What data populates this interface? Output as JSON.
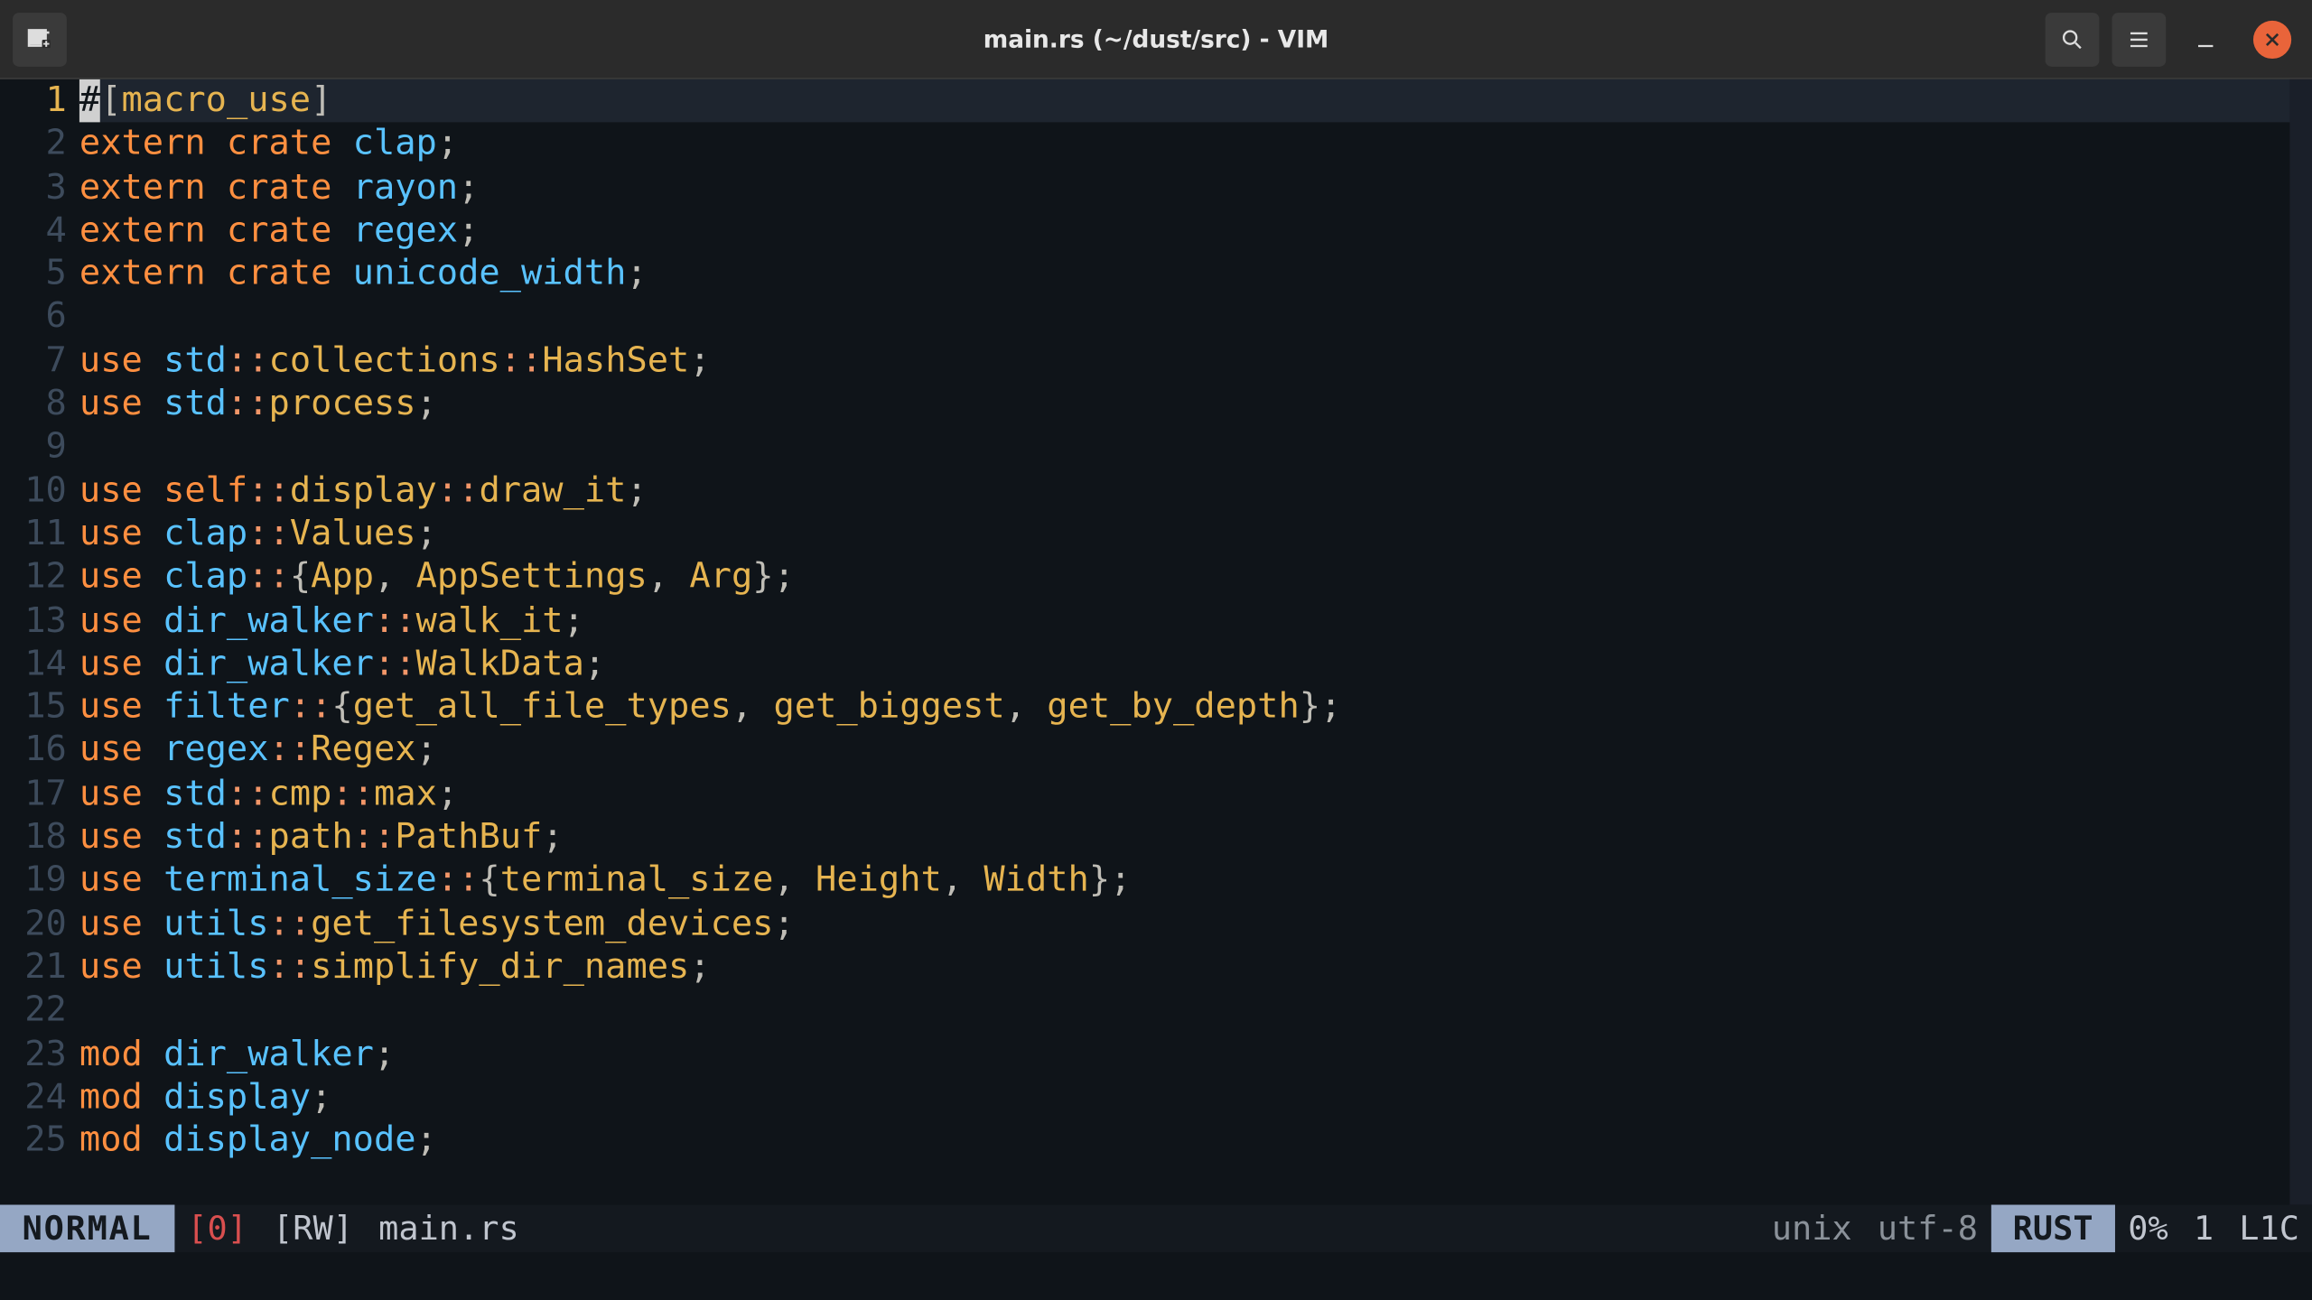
{
  "window": {
    "title": "main.rs (~/dust/src) - VIM"
  },
  "editor": {
    "current_line": 1,
    "lines": [
      {
        "n": 1,
        "tokens": [
          {
            "cursor": true,
            "t": "#"
          },
          {
            "c": "brkt",
            "t": "["
          },
          {
            "c": "attr",
            "t": "macro_use"
          },
          {
            "c": "brkt",
            "t": "]"
          }
        ]
      },
      {
        "n": 2,
        "tokens": [
          {
            "c": "kw",
            "t": "extern crate "
          },
          {
            "c": "ty",
            "t": "clap"
          },
          {
            "c": "punc",
            "t": ";"
          }
        ]
      },
      {
        "n": 3,
        "tokens": [
          {
            "c": "kw",
            "t": "extern crate "
          },
          {
            "c": "ty",
            "t": "rayon"
          },
          {
            "c": "punc",
            "t": ";"
          }
        ]
      },
      {
        "n": 4,
        "tokens": [
          {
            "c": "kw",
            "t": "extern crate "
          },
          {
            "c": "ty",
            "t": "regex"
          },
          {
            "c": "punc",
            "t": ";"
          }
        ]
      },
      {
        "n": 5,
        "tokens": [
          {
            "c": "kw",
            "t": "extern crate "
          },
          {
            "c": "ty",
            "t": "unicode_width"
          },
          {
            "c": "punc",
            "t": ";"
          }
        ]
      },
      {
        "n": 6,
        "tokens": []
      },
      {
        "n": 7,
        "tokens": [
          {
            "c": "kw",
            "t": "use "
          },
          {
            "c": "ty",
            "t": "std"
          },
          {
            "c": "op",
            "t": "::"
          },
          {
            "c": "path",
            "t": "collections"
          },
          {
            "c": "op",
            "t": "::"
          },
          {
            "c": "path",
            "t": "HashSet"
          },
          {
            "c": "punc",
            "t": ";"
          }
        ]
      },
      {
        "n": 8,
        "tokens": [
          {
            "c": "kw",
            "t": "use "
          },
          {
            "c": "ty",
            "t": "std"
          },
          {
            "c": "op",
            "t": "::"
          },
          {
            "c": "path",
            "t": "process"
          },
          {
            "c": "punc",
            "t": ";"
          }
        ]
      },
      {
        "n": 9,
        "tokens": []
      },
      {
        "n": 10,
        "tokens": [
          {
            "c": "kw",
            "t": "use "
          },
          {
            "c": "kw",
            "t": "self"
          },
          {
            "c": "op",
            "t": "::"
          },
          {
            "c": "path",
            "t": "display"
          },
          {
            "c": "op",
            "t": "::"
          },
          {
            "c": "path",
            "t": "draw_it"
          },
          {
            "c": "punc",
            "t": ";"
          }
        ]
      },
      {
        "n": 11,
        "tokens": [
          {
            "c": "kw",
            "t": "use "
          },
          {
            "c": "ty",
            "t": "clap"
          },
          {
            "c": "op",
            "t": "::"
          },
          {
            "c": "path",
            "t": "Values"
          },
          {
            "c": "punc",
            "t": ";"
          }
        ]
      },
      {
        "n": 12,
        "tokens": [
          {
            "c": "kw",
            "t": "use "
          },
          {
            "c": "ty",
            "t": "clap"
          },
          {
            "c": "op",
            "t": "::"
          },
          {
            "c": "brkt",
            "t": "{"
          },
          {
            "c": "path",
            "t": "App"
          },
          {
            "c": "punc",
            "t": ", "
          },
          {
            "c": "path",
            "t": "AppSettings"
          },
          {
            "c": "punc",
            "t": ", "
          },
          {
            "c": "path",
            "t": "Arg"
          },
          {
            "c": "brkt",
            "t": "}"
          },
          {
            "c": "punc",
            "t": ";"
          }
        ]
      },
      {
        "n": 13,
        "tokens": [
          {
            "c": "kw",
            "t": "use "
          },
          {
            "c": "ty",
            "t": "dir_walker"
          },
          {
            "c": "op",
            "t": "::"
          },
          {
            "c": "path",
            "t": "walk_it"
          },
          {
            "c": "punc",
            "t": ";"
          }
        ]
      },
      {
        "n": 14,
        "tokens": [
          {
            "c": "kw",
            "t": "use "
          },
          {
            "c": "ty",
            "t": "dir_walker"
          },
          {
            "c": "op",
            "t": "::"
          },
          {
            "c": "path",
            "t": "WalkData"
          },
          {
            "c": "punc",
            "t": ";"
          }
        ]
      },
      {
        "n": 15,
        "tokens": [
          {
            "c": "kw",
            "t": "use "
          },
          {
            "c": "ty",
            "t": "filter"
          },
          {
            "c": "op",
            "t": "::"
          },
          {
            "c": "brkt",
            "t": "{"
          },
          {
            "c": "path",
            "t": "get_all_file_types"
          },
          {
            "c": "punc",
            "t": ", "
          },
          {
            "c": "path",
            "t": "get_biggest"
          },
          {
            "c": "punc",
            "t": ", "
          },
          {
            "c": "path",
            "t": "get_by_depth"
          },
          {
            "c": "brkt",
            "t": "}"
          },
          {
            "c": "punc",
            "t": ";"
          }
        ]
      },
      {
        "n": 16,
        "tokens": [
          {
            "c": "kw",
            "t": "use "
          },
          {
            "c": "ty",
            "t": "regex"
          },
          {
            "c": "op",
            "t": "::"
          },
          {
            "c": "path",
            "t": "Regex"
          },
          {
            "c": "punc",
            "t": ";"
          }
        ]
      },
      {
        "n": 17,
        "tokens": [
          {
            "c": "kw",
            "t": "use "
          },
          {
            "c": "ty",
            "t": "std"
          },
          {
            "c": "op",
            "t": "::"
          },
          {
            "c": "path",
            "t": "cmp"
          },
          {
            "c": "op",
            "t": "::"
          },
          {
            "c": "path",
            "t": "max"
          },
          {
            "c": "punc",
            "t": ";"
          }
        ]
      },
      {
        "n": 18,
        "tokens": [
          {
            "c": "kw",
            "t": "use "
          },
          {
            "c": "ty",
            "t": "std"
          },
          {
            "c": "op",
            "t": "::"
          },
          {
            "c": "path",
            "t": "path"
          },
          {
            "c": "op",
            "t": "::"
          },
          {
            "c": "path",
            "t": "PathBuf"
          },
          {
            "c": "punc",
            "t": ";"
          }
        ]
      },
      {
        "n": 19,
        "tokens": [
          {
            "c": "kw",
            "t": "use "
          },
          {
            "c": "ty",
            "t": "terminal_size"
          },
          {
            "c": "op",
            "t": "::"
          },
          {
            "c": "brkt",
            "t": "{"
          },
          {
            "c": "path",
            "t": "terminal_size"
          },
          {
            "c": "punc",
            "t": ", "
          },
          {
            "c": "path",
            "t": "Height"
          },
          {
            "c": "punc",
            "t": ", "
          },
          {
            "c": "path",
            "t": "Width"
          },
          {
            "c": "brkt",
            "t": "}"
          },
          {
            "c": "punc",
            "t": ";"
          }
        ]
      },
      {
        "n": 20,
        "tokens": [
          {
            "c": "kw",
            "t": "use "
          },
          {
            "c": "ty",
            "t": "utils"
          },
          {
            "c": "op",
            "t": "::"
          },
          {
            "c": "path",
            "t": "get_filesystem_devices"
          },
          {
            "c": "punc",
            "t": ";"
          }
        ]
      },
      {
        "n": 21,
        "tokens": [
          {
            "c": "kw",
            "t": "use "
          },
          {
            "c": "ty",
            "t": "utils"
          },
          {
            "c": "op",
            "t": "::"
          },
          {
            "c": "path",
            "t": "simplify_dir_names"
          },
          {
            "c": "punc",
            "t": ";"
          }
        ]
      },
      {
        "n": 22,
        "tokens": []
      },
      {
        "n": 23,
        "tokens": [
          {
            "c": "kw",
            "t": "mod "
          },
          {
            "c": "ty",
            "t": "dir_walker"
          },
          {
            "c": "punc",
            "t": ";"
          }
        ]
      },
      {
        "n": 24,
        "tokens": [
          {
            "c": "kw",
            "t": "mod "
          },
          {
            "c": "ty",
            "t": "display"
          },
          {
            "c": "punc",
            "t": ";"
          }
        ]
      },
      {
        "n": 25,
        "tokens": [
          {
            "c": "kw",
            "t": "mod "
          },
          {
            "c": "ty",
            "t": "display_node"
          },
          {
            "c": "punc",
            "t": ";"
          }
        ]
      }
    ]
  },
  "statusline": {
    "mode": "NORMAL",
    "zero": "[0]",
    "rw": "[RW]",
    "file": "main.rs",
    "format": "unix",
    "encoding": "utf-8",
    "lang": "RUST",
    "percent": "0%",
    "line": "1",
    "pos": "L1C"
  }
}
